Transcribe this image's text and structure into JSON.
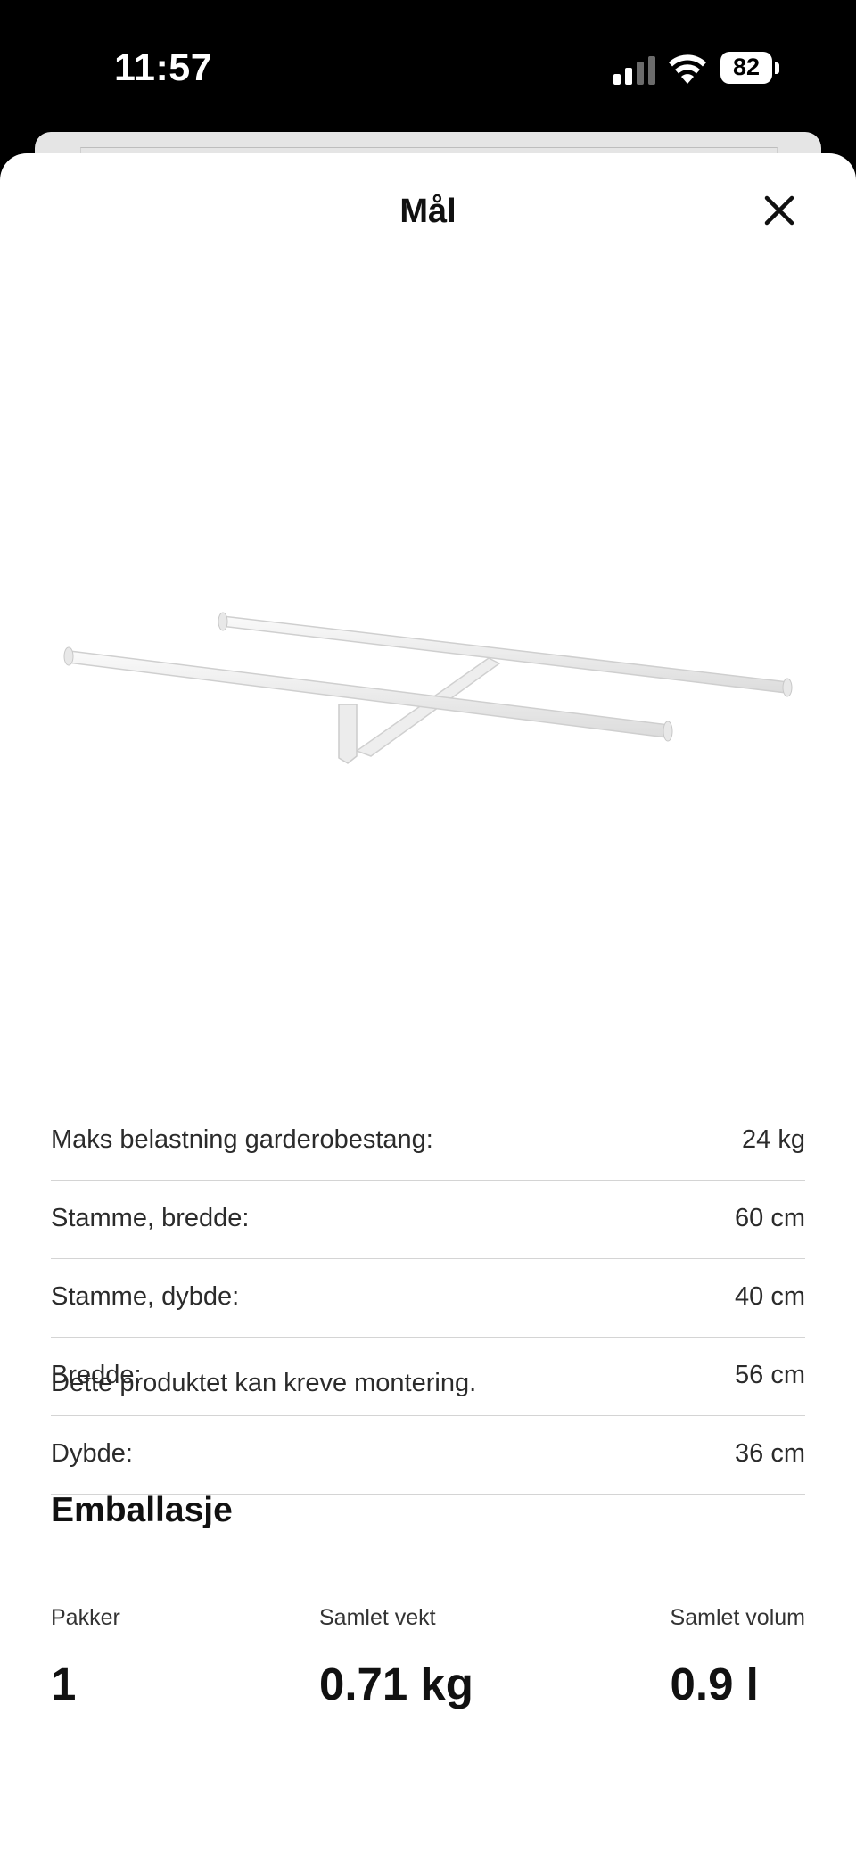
{
  "status_bar": {
    "time": "11:57",
    "battery": "82"
  },
  "sheet": {
    "title": "Mål",
    "close_icon": "close-icon"
  },
  "specs": [
    {
      "label": "Maks belastning garderobestang:",
      "value": "24 kg"
    },
    {
      "label": "Stamme, bredde:",
      "value": "60 cm"
    },
    {
      "label": "Stamme, dybde:",
      "value": "40 cm"
    },
    {
      "label": "Bredde:",
      "value": "56 cm"
    },
    {
      "label": "Dybde:",
      "value": "36 cm"
    }
  ],
  "note": "Dette produktet kan kreve montering.",
  "packaging": {
    "title": "Emballasje",
    "packages_label": "Pakker",
    "packages_value": "1",
    "weight_label": "Samlet vekt",
    "weight_value": "0.71 kg",
    "volume_label": "Samlet volum",
    "volume_value": "0.9 l"
  },
  "colors": {
    "background": "#000000",
    "sheet": "#ffffff",
    "divider": "#d4d4d4",
    "text": "#111111"
  }
}
